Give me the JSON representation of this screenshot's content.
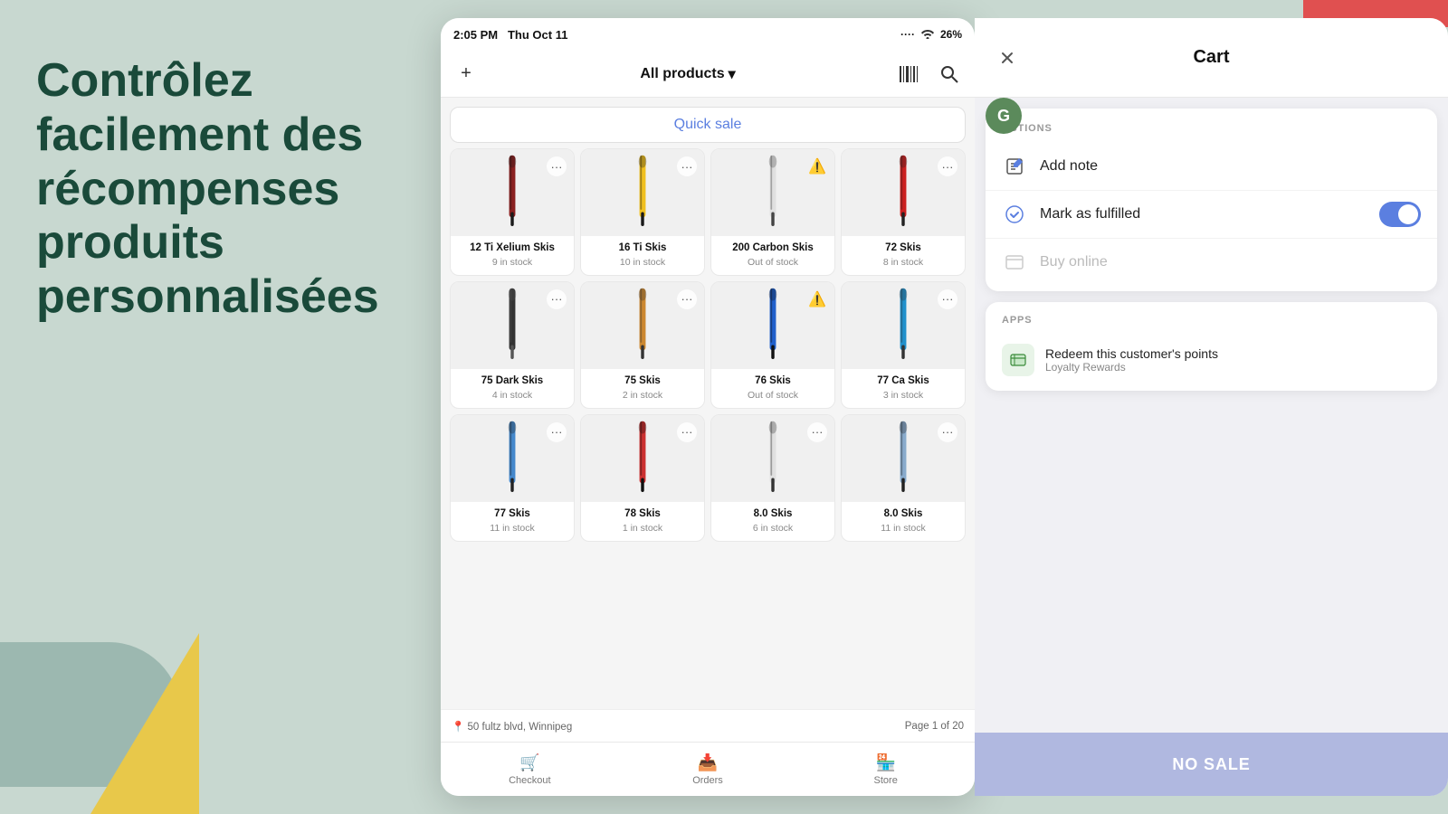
{
  "background": {
    "hero_text": "Contrôlez facilement des récompenses produits personnalisées"
  },
  "status_bar": {
    "time": "2:05 PM",
    "date": "Thu Oct 11",
    "signal": "····",
    "wifi": "WiFi",
    "battery": "26%"
  },
  "header": {
    "add_label": "+",
    "title": "All products",
    "dropdown_icon": "▾",
    "barcode_icon": "barcode",
    "search_icon": "search"
  },
  "quick_sale": {
    "label": "Quick sale"
  },
  "products": [
    {
      "name": "12 Ti Xelium Skis",
      "stock": "9 in stock",
      "out": false,
      "color1": "#8B2020",
      "color2": "#1a1a1a"
    },
    {
      "name": "16 Ti Skis",
      "stock": "10 in stock",
      "out": false,
      "color1": "#f0c020",
      "color2": "#1a1a1a"
    },
    {
      "name": "200 Carbon Skis",
      "stock": "Out of stock",
      "out": true,
      "color1": "#e0e0e0",
      "color2": "#444"
    },
    {
      "name": "72 Skis",
      "stock": "8 in stock",
      "out": false,
      "color1": "#cc2020",
      "color2": "#222"
    },
    {
      "name": "75 Dark Skis",
      "stock": "4 in stock",
      "out": false,
      "color1": "#333",
      "color2": "#555"
    },
    {
      "name": "75 Skis",
      "stock": "2 in stock",
      "out": false,
      "color1": "#cc8830",
      "color2": "#333"
    },
    {
      "name": "76 Skis",
      "stock": "Out of stock",
      "out": true,
      "color1": "#2060cc",
      "color2": "#111"
    },
    {
      "name": "77 Ca Skis",
      "stock": "3 in stock",
      "out": false,
      "color1": "#2090cc",
      "color2": "#333"
    },
    {
      "name": "77 Skis",
      "stock": "11 in stock",
      "out": false,
      "color1": "#4488cc",
      "color2": "#222"
    },
    {
      "name": "78 Skis",
      "stock": "1 in stock",
      "out": false,
      "color1": "#cc3030",
      "color2": "#111"
    },
    {
      "name": "8.0 Skis",
      "stock": "6 in stock",
      "out": false,
      "color1": "#e0e0e0",
      "color2": "#333"
    },
    {
      "name": "8.0 Skis",
      "stock": "11 in stock",
      "out": false,
      "color1": "#88aacc",
      "color2": "#222"
    }
  ],
  "footer": {
    "location": "📍 50 fultz blvd, Winnipeg",
    "page": "Page 1 of 20"
  },
  "bottom_tabs": [
    {
      "icon": "🛒",
      "label": "Checkout"
    },
    {
      "icon": "📥",
      "label": "Orders"
    },
    {
      "icon": "🏪",
      "label": "Store"
    }
  ],
  "cart": {
    "title": "Cart",
    "customer_initial": "G"
  },
  "actions": {
    "section_title": "ACTIONS",
    "items": [
      {
        "label": "Add note",
        "icon": "📝",
        "disabled": false,
        "has_toggle": false
      },
      {
        "label": "Mark as fulfilled",
        "icon": "✅",
        "disabled": false,
        "has_toggle": true,
        "toggle_on": true
      },
      {
        "label": "Buy online",
        "icon": "🖥",
        "disabled": true,
        "has_toggle": false
      }
    ]
  },
  "apps": {
    "section_title": "APPS",
    "items": [
      {
        "name": "Redeem this customer's points",
        "sub": "Loyalty Rewards",
        "icon": "🎁"
      }
    ]
  },
  "no_sale": {
    "label": "NO SALE"
  }
}
